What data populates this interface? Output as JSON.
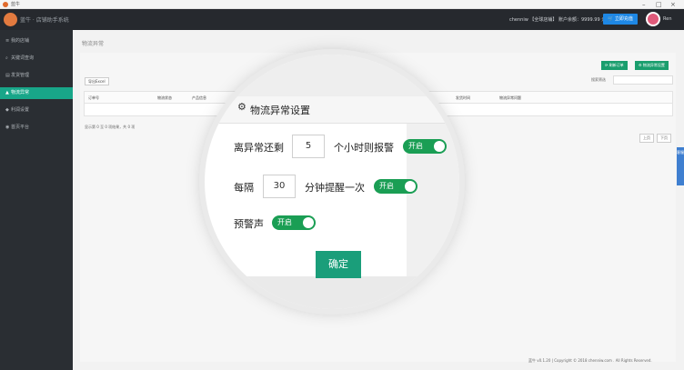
{
  "window": {
    "title": "蓝牛"
  },
  "topbar": {
    "brand": "蓝牛 · 店铺助手系统",
    "info": "chenniw 【全球店铺】 账户余额：9999.99 元",
    "shop_button": "立即充值",
    "username": "Ren"
  },
  "sidebar": {
    "items": [
      {
        "icon": "≡",
        "label": "我的店铺",
        "active": false
      },
      {
        "icon": "⌕",
        "label": "关键词查询",
        "active": false
      },
      {
        "icon": "▤",
        "label": "发货管理",
        "active": false
      },
      {
        "icon": "▲",
        "label": "物流异常",
        "active": true
      },
      {
        "icon": "◆",
        "label": "利润设置",
        "active": false
      },
      {
        "icon": "◉",
        "label": "首页平台",
        "active": false
      }
    ]
  },
  "page": {
    "title": "物流异常",
    "buttons": {
      "refresh": "⟳ 刷新订单",
      "settings": "⚙ 物流异常设置"
    },
    "export_button": "导出Excel",
    "search_label": "搜索筛选",
    "columns": [
      "订单号",
      "物流状态",
      "产品信息",
      "发货时间",
      "物流异常问题"
    ],
    "pager_text": "显示第 0 至 0 项结果，共 0 项",
    "pager": {
      "prev": "上页",
      "next": "下页"
    },
    "side_tab": "客服"
  },
  "footer": "蓝牛 v0.1.20 | Copyright © 2018 chenniw.com . All Rights Reserved.",
  "dialog": {
    "title": "物流异常设置",
    "row1": {
      "prefix": "离异常还剩",
      "value": "5",
      "suffix": "个小时则报警",
      "toggle": "开启"
    },
    "row2": {
      "prefix": "每隔",
      "value": "30",
      "suffix": "分钟提醒一次",
      "toggle": "开启"
    },
    "row3": {
      "prefix": "预警声",
      "toggle": "开启"
    },
    "confirm": "确定"
  }
}
